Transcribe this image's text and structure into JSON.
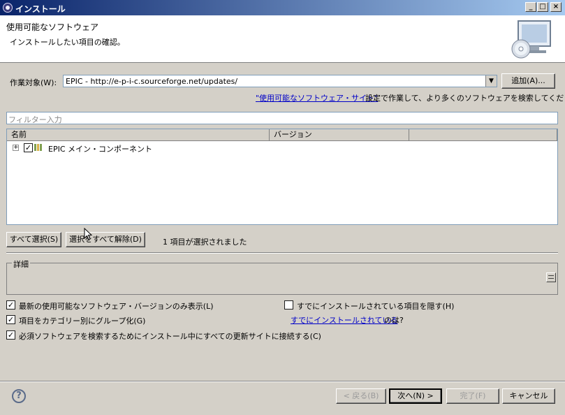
{
  "window": {
    "title": "インストール",
    "buttons": {
      "minimize": "_",
      "maximize": "□",
      "close": "×"
    }
  },
  "banner": {
    "heading": "使用可能なソフトウェア",
    "subheading": "インストールしたい項目の確認。",
    "icon": "monitor-cd-icon"
  },
  "work_with": {
    "label": "作業対象(W):",
    "value": "EPIC - http://e-p-i-c.sourceforge.net/updates/",
    "add_button": "追加(A)...",
    "hint_link": "\"使用可能なソフトウェア・サイト\"",
    "hint_text": "設定で作業して、より多くのソフトウェアを検索してください。"
  },
  "filter": {
    "placeholder": "フィルター入力"
  },
  "tree": {
    "columns": [
      "名前",
      "バージョン",
      ""
    ],
    "items": [
      {
        "label": "EPIC メイン・コンポーネント",
        "version": "",
        "checked": true,
        "expanded": false
      }
    ]
  },
  "selection": {
    "select_all": "すべて選択(S)",
    "deselect_all": "選択をすべて解除(D)",
    "status": "1 項目が選択されました"
  },
  "details": {
    "label": "詳細"
  },
  "options": [
    {
      "label": "最新の使用可能なソフトウェア・バージョンのみ表示(L)",
      "checked": true
    },
    {
      "label": "項目をカテゴリー別にグループ化(G)",
      "checked": true
    },
    {
      "label": "必須ソフトウェアを検索するためにインストール中にすべての更新サイトに接続する(C)",
      "checked": true
    },
    {
      "label": "すでにインストールされている項目を隠す(H)",
      "checked": false
    }
  ],
  "installed": {
    "link": "すでにインストールされている",
    "suffix": "のは?"
  },
  "footer": {
    "help_icon": "?",
    "back": "< 戻る(B)",
    "next": "次へ(N) >",
    "finish": "完了(F)",
    "cancel": "キャンセル"
  }
}
